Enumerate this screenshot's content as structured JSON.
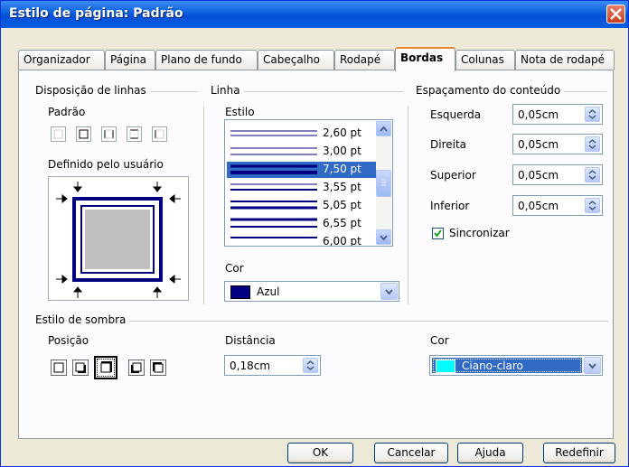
{
  "window": {
    "title": "Estilo de página: Padrão"
  },
  "tabs": [
    "Organizador",
    "Página",
    "Plano de fundo",
    "Cabeçalho",
    "Rodapé",
    "Bordas",
    "Colunas",
    "Nota de rodapé"
  ],
  "active_tab": "Bordas",
  "line_arrangement": {
    "group_label": "Disposição de linhas",
    "default_label": "Padrão",
    "user_defined_label": "Definido pelo usuário"
  },
  "line": {
    "group_label": "Linha",
    "style_label": "Estilo",
    "styles": [
      "2,60 pt",
      "3,00 pt",
      "7,50 pt",
      "3,55 pt",
      "5,05 pt",
      "6,55 pt",
      "6,00 pt"
    ],
    "selected_style": "7,50 pt",
    "color_label": "Cor",
    "color_value": "Azul",
    "color_swatch": "#000080"
  },
  "spacing": {
    "group_label": "Espaçamento do conteúdo",
    "left_label": "Esquerda",
    "left_value": "0,05cm",
    "right_label": "Direita",
    "right_value": "0,05cm",
    "top_label": "Superior",
    "top_value": "0,05cm",
    "bottom_label": "Inferior",
    "bottom_value": "0,05cm",
    "sync_label": "Sincronizar",
    "sync_checked": true
  },
  "shadow": {
    "group_label": "Estilo de sombra",
    "position_label": "Posição",
    "distance_label": "Distância",
    "distance_value": "0,18cm",
    "color_label": "Cor",
    "color_value": "Ciano-claro",
    "color_swatch": "#00ffff"
  },
  "buttons": {
    "ok": "OK",
    "cancel": "Cancelar",
    "help": "Ajuda",
    "reset": "Redefinir"
  }
}
